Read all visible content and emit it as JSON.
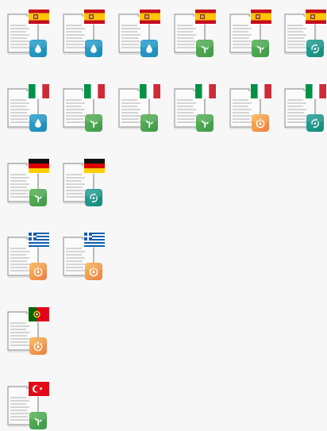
{
  "theme": {
    "page_background": "#f7f7f7",
    "doc_fill": "#fbfbfb",
    "doc_stroke": "#aaaaaa",
    "doc_lines": "#bdbdbd"
  },
  "badge_types": {
    "water": {
      "icon": "water-drop-icon",
      "color": "#2ea2cf",
      "color_dark": "#1b8bb8"
    },
    "plant": {
      "icon": "sprout-icon",
      "color": "#5bb35a",
      "color_dark": "#3f9a46"
    },
    "energy": {
      "icon": "plug-icon",
      "color": "#f7b650",
      "color_dark": "#ee7e48"
    },
    "cycle": {
      "icon": "recycle-icon",
      "color": "#2aa39a",
      "color_dark": "#148a78"
    }
  },
  "flags": {
    "es": {
      "name": "spain-flag-icon"
    },
    "it": {
      "name": "italy-flag-icon"
    },
    "de": {
      "name": "germany-flag-icon"
    },
    "gr": {
      "name": "greece-flag-icon"
    },
    "pt": {
      "name": "portugal-flag-icon"
    },
    "tr": {
      "name": "turkey-flag-icon"
    }
  },
  "rows": [
    {
      "flag": "es",
      "items": [
        "water",
        "water",
        "water",
        "plant",
        "plant",
        "cycle"
      ]
    },
    {
      "flag": "it",
      "items": [
        "water",
        "plant",
        "plant",
        "plant",
        "energy",
        "cycle"
      ]
    },
    {
      "flag": "de",
      "items": [
        "plant",
        "cycle"
      ]
    },
    {
      "flag": "gr",
      "items": [
        "energy",
        "energy"
      ]
    },
    {
      "flag": "pt",
      "items": [
        "energy"
      ]
    },
    {
      "flag": "tr",
      "items": [
        "plant"
      ]
    }
  ]
}
